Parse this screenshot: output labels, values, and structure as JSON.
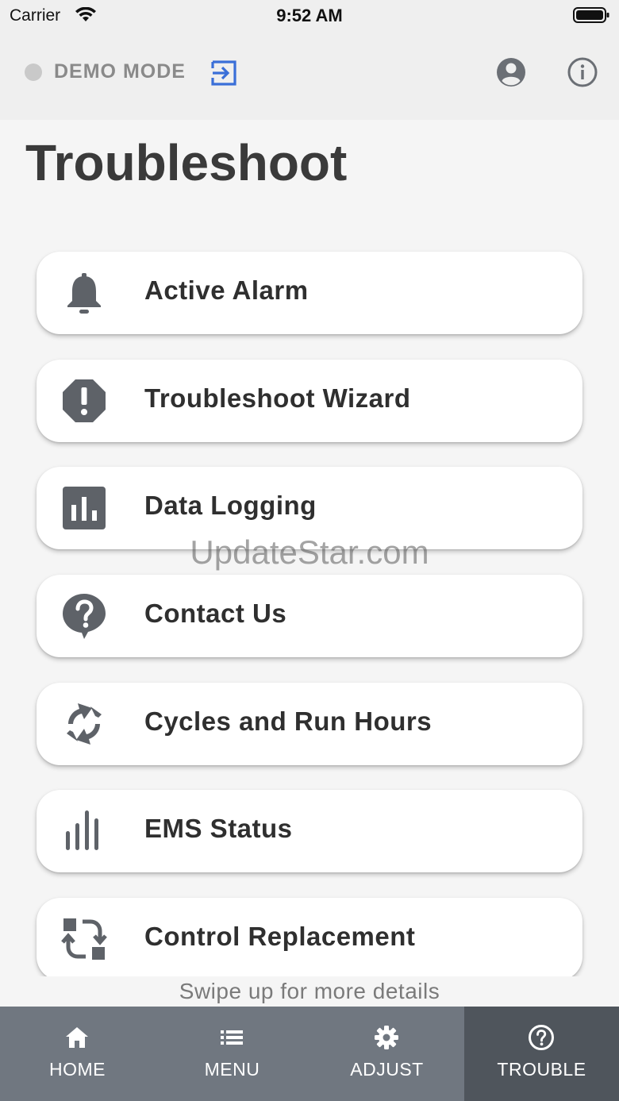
{
  "status_bar": {
    "carrier": "Carrier",
    "time": "9:52 AM"
  },
  "header": {
    "mode_label": "DEMO MODE",
    "exit_icon": "exit-icon",
    "user_icon": "user-icon",
    "info_icon": "info-icon",
    "accent_color": "#3a6fd8"
  },
  "page": {
    "title": "Troubleshoot"
  },
  "items": [
    {
      "label": "Active Alarm",
      "icon": "bell-icon"
    },
    {
      "label": "Troubleshoot Wizard",
      "icon": "alert-octagon-icon"
    },
    {
      "label": "Data Logging",
      "icon": "bar-chart-icon"
    },
    {
      "label": "Contact Us",
      "icon": "help-bubble-icon"
    },
    {
      "label": "Cycles and Run Hours",
      "icon": "cycle-icon"
    },
    {
      "label": "EMS Status",
      "icon": "signal-bars-icon"
    },
    {
      "label": "Control Replacement",
      "icon": "swap-icon"
    }
  ],
  "watermark": "UpdateStar.com",
  "swipe_hint": "Swipe up for more details",
  "nav": {
    "tabs": [
      {
        "label": "HOME",
        "icon": "home-icon"
      },
      {
        "label": "MENU",
        "icon": "list-icon"
      },
      {
        "label": "ADJUST",
        "icon": "gear-icon"
      },
      {
        "label": "TROUBLE",
        "icon": "question-circle-icon"
      }
    ],
    "active": "TROUBLE"
  }
}
